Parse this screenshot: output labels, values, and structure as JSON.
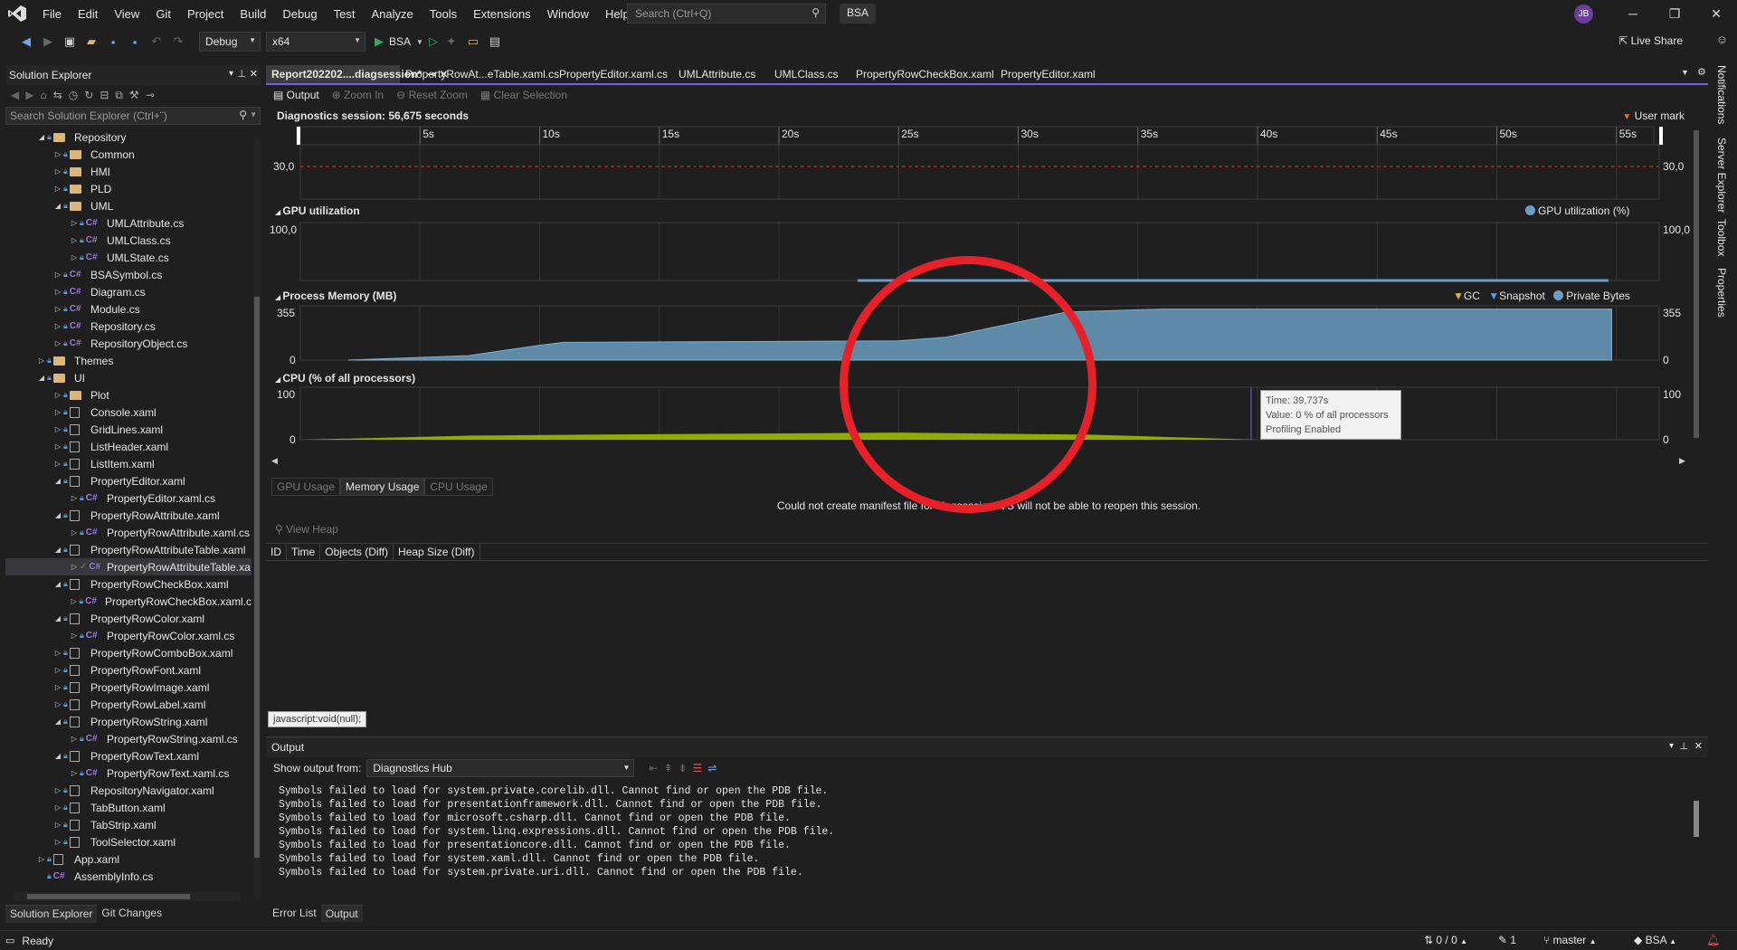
{
  "menu": {
    "items": [
      "File",
      "Edit",
      "View",
      "Git",
      "Project",
      "Build",
      "Debug",
      "Test",
      "Analyze",
      "Tools",
      "Extensions",
      "Window",
      "Help"
    ]
  },
  "search": {
    "placeholder": "Search (Ctrl+Q)"
  },
  "solution_name": "BSA",
  "user_initials": "JB",
  "toolbar": {
    "config": "Debug",
    "platform": "x64",
    "run_target": "BSA",
    "live_share": "Live Share"
  },
  "solution_explorer": {
    "title": "Solution Explorer",
    "search_placeholder": "Search Solution Explorer (Ctrl+¨)",
    "tabs": [
      "Solution Explorer",
      "Git Changes"
    ],
    "tree": [
      {
        "label": "Repository",
        "indent": 1,
        "type": "folder",
        "exp": "open"
      },
      {
        "label": "Common",
        "indent": 2,
        "type": "folder",
        "exp": "closed"
      },
      {
        "label": "HMI",
        "indent": 2,
        "type": "folder",
        "exp": "closed"
      },
      {
        "label": "PLD",
        "indent": 2,
        "type": "folder",
        "exp": "closed"
      },
      {
        "label": "UML",
        "indent": 2,
        "type": "folder",
        "exp": "open"
      },
      {
        "label": "UMLAttribute.cs",
        "indent": 3,
        "type": "cs",
        "exp": "closed"
      },
      {
        "label": "UMLClass.cs",
        "indent": 3,
        "type": "cs",
        "exp": "closed"
      },
      {
        "label": "UMLState.cs",
        "indent": 3,
        "type": "cs",
        "exp": "closed"
      },
      {
        "label": "BSASymbol.cs",
        "indent": 2,
        "type": "cs",
        "exp": "closed"
      },
      {
        "label": "Diagram.cs",
        "indent": 2,
        "type": "cs",
        "exp": "closed"
      },
      {
        "label": "Module.cs",
        "indent": 2,
        "type": "cs",
        "exp": "closed"
      },
      {
        "label": "Repository.cs",
        "indent": 2,
        "type": "cs",
        "exp": "closed"
      },
      {
        "label": "RepositoryObject.cs",
        "indent": 2,
        "type": "cs",
        "exp": "closed"
      },
      {
        "label": "Themes",
        "indent": 1,
        "type": "folder",
        "exp": "closed"
      },
      {
        "label": "UI",
        "indent": 1,
        "type": "folder",
        "exp": "open"
      },
      {
        "label": "Plot",
        "indent": 2,
        "type": "folder",
        "exp": "closed"
      },
      {
        "label": "Console.xaml",
        "indent": 2,
        "type": "xaml",
        "exp": "closed"
      },
      {
        "label": "GridLines.xaml",
        "indent": 2,
        "type": "xaml",
        "exp": "closed"
      },
      {
        "label": "ListHeader.xaml",
        "indent": 2,
        "type": "xaml",
        "exp": "closed"
      },
      {
        "label": "ListItem.xaml",
        "indent": 2,
        "type": "xaml",
        "exp": "closed"
      },
      {
        "label": "PropertyEditor.xaml",
        "indent": 2,
        "type": "xaml",
        "exp": "open"
      },
      {
        "label": "PropertyEditor.xaml.cs",
        "indent": 3,
        "type": "cs",
        "exp": "closed"
      },
      {
        "label": "PropertyRowAttribute.xaml",
        "indent": 2,
        "type": "xaml",
        "exp": "open"
      },
      {
        "label": "PropertyRowAttribute.xaml.cs",
        "indent": 3,
        "type": "cs",
        "exp": "closed"
      },
      {
        "label": "PropertyRowAttributeTable.xaml",
        "indent": 2,
        "type": "xaml",
        "exp": "open"
      },
      {
        "label": "PropertyRowAttributeTable.xa",
        "indent": 3,
        "type": "cs",
        "exp": "closed",
        "sel": true,
        "check": true
      },
      {
        "label": "PropertyRowCheckBox.xaml",
        "indent": 2,
        "type": "xaml",
        "exp": "open"
      },
      {
        "label": "PropertyRowCheckBox.xaml.c",
        "indent": 3,
        "type": "cs",
        "exp": "closed"
      },
      {
        "label": "PropertyRowColor.xaml",
        "indent": 2,
        "type": "xaml",
        "exp": "open"
      },
      {
        "label": "PropertyRowColor.xaml.cs",
        "indent": 3,
        "type": "cs",
        "exp": "closed"
      },
      {
        "label": "PropertyRowComboBox.xaml",
        "indent": 2,
        "type": "xaml",
        "exp": "closed"
      },
      {
        "label": "PropertyRowFont.xaml",
        "indent": 2,
        "type": "xaml",
        "exp": "closed"
      },
      {
        "label": "PropertyRowImage.xaml",
        "indent": 2,
        "type": "xaml",
        "exp": "closed"
      },
      {
        "label": "PropertyRowLabel.xaml",
        "indent": 2,
        "type": "xaml",
        "exp": "closed"
      },
      {
        "label": "PropertyRowString.xaml",
        "indent": 2,
        "type": "xaml",
        "exp": "open"
      },
      {
        "label": "PropertyRowString.xaml.cs",
        "indent": 3,
        "type": "cs",
        "exp": "closed"
      },
      {
        "label": "PropertyRowText.xaml",
        "indent": 2,
        "type": "xaml",
        "exp": "open"
      },
      {
        "label": "PropertyRowText.xaml.cs",
        "indent": 3,
        "type": "cs",
        "exp": "closed"
      },
      {
        "label": "RepositoryNavigator.xaml",
        "indent": 2,
        "type": "xaml",
        "exp": "closed"
      },
      {
        "label": "TabButton.xaml",
        "indent": 2,
        "type": "xaml",
        "exp": "closed"
      },
      {
        "label": "TabStrip.xaml",
        "indent": 2,
        "type": "xaml",
        "exp": "closed"
      },
      {
        "label": "ToolSelector.xaml",
        "indent": 2,
        "type": "xaml",
        "exp": "closed"
      },
      {
        "label": "App.xaml",
        "indent": 1,
        "type": "xaml",
        "exp": "closed"
      },
      {
        "label": "AssemblyInfo.cs",
        "indent": 1,
        "type": "cs",
        "exp": "none"
      }
    ]
  },
  "doc_tabs": [
    "Report202202....diagsession*",
    "PropertyRowAt...eTable.xaml.cs",
    "PropertyEditor.xaml.cs",
    "UMLAttribute.cs",
    "UMLClass.cs",
    "PropertyRowCheckBox.xaml",
    "PropertyEditor.xaml"
  ],
  "diag_toolbar": {
    "output": "Output",
    "zoom_in": "Zoom In",
    "reset_zoom": "Reset Zoom",
    "clear_selection": "Clear Selection"
  },
  "diagnostics": {
    "session_label": "Diagnostics session: 56,675 seconds",
    "user_mark": "User mark",
    "ruler_ticks": [
      "5s",
      "10s",
      "15s",
      "20s",
      "25s",
      "30s",
      "35s",
      "40s",
      "45s",
      "50s",
      "55s"
    ],
    "top_value": "30,0",
    "gpu": {
      "title": "GPU utilization",
      "legend": "GPU utilization (%)",
      "max": "100,0"
    },
    "memory": {
      "title": "Process Memory (MB)",
      "legend_gc": "GC",
      "legend_snapshot": "Snapshot",
      "legend_private": "Private Bytes",
      "max": "355",
      "min": "0"
    },
    "cpu": {
      "title": "CPU (% of all processors)",
      "max": "100",
      "min": "0"
    },
    "tooltip": {
      "line1": "Time: 39,737s",
      "line2": "Value: 0 % of all processors",
      "line3": "Profiling Enabled"
    }
  },
  "chart_data": [
    {
      "type": "area",
      "title": "Process Memory (MB)",
      "xlabel": "",
      "ylabel": "",
      "ylim": [
        0,
        355
      ],
      "x": [
        2,
        7,
        10,
        11,
        25,
        27,
        32,
        36,
        54.8
      ],
      "series": [
        {
          "name": "Private Bytes",
          "values": [
            0,
            30,
            100,
            120,
            130,
            155,
            325,
            345,
            345
          ]
        }
      ]
    },
    {
      "type": "area",
      "title": "CPU (% of all processors)",
      "xlabel": "",
      "ylabel": "",
      "ylim": [
        0,
        100
      ],
      "x": [
        0,
        7,
        12,
        25,
        33,
        40,
        56
      ],
      "series": [
        {
          "values": [
            0,
            8,
            10,
            14,
            10,
            0,
            0
          ]
        }
      ]
    }
  ],
  "sub_tabs": [
    "GPU Usage",
    "Memory Usage",
    "CPU Usage"
  ],
  "manifest_message": "Could not create manifest file for diagsession. VS will not be able to reopen this session.",
  "view_heap": "View Heap",
  "heap_columns": [
    "ID",
    "Time",
    "Objects (Diff)",
    "Heap Size (Diff)"
  ],
  "status_url": "javascript:void(null);",
  "output": {
    "title": "Output",
    "show_from_label": "Show output from:",
    "source": "Diagnostics Hub",
    "lines": [
      "Symbols failed to load for system.private.corelib.dll. Cannot find or open the PDB file.",
      "Symbols failed to load for presentationframework.dll. Cannot find or open the PDB file.",
      "Symbols failed to load for microsoft.csharp.dll. Cannot find or open the PDB file.",
      "Symbols failed to load for system.linq.expressions.dll. Cannot find or open the PDB file.",
      "Symbols failed to load for presentationcore.dll. Cannot find or open the PDB file.",
      "Symbols failed to load for system.xaml.dll. Cannot find or open the PDB file.",
      "Symbols failed to load for system.private.uri.dll. Cannot find or open the PDB file."
    ]
  },
  "bottom_tabs": [
    "Error List",
    "Output"
  ],
  "right_strip": [
    "Notifications",
    "Server Explorer",
    "Toolbox",
    "Properties"
  ],
  "statusbar": {
    "ready": "Ready",
    "sync": "0 / 0",
    "pencil": "1",
    "branch": "master",
    "repo": "BSA"
  }
}
